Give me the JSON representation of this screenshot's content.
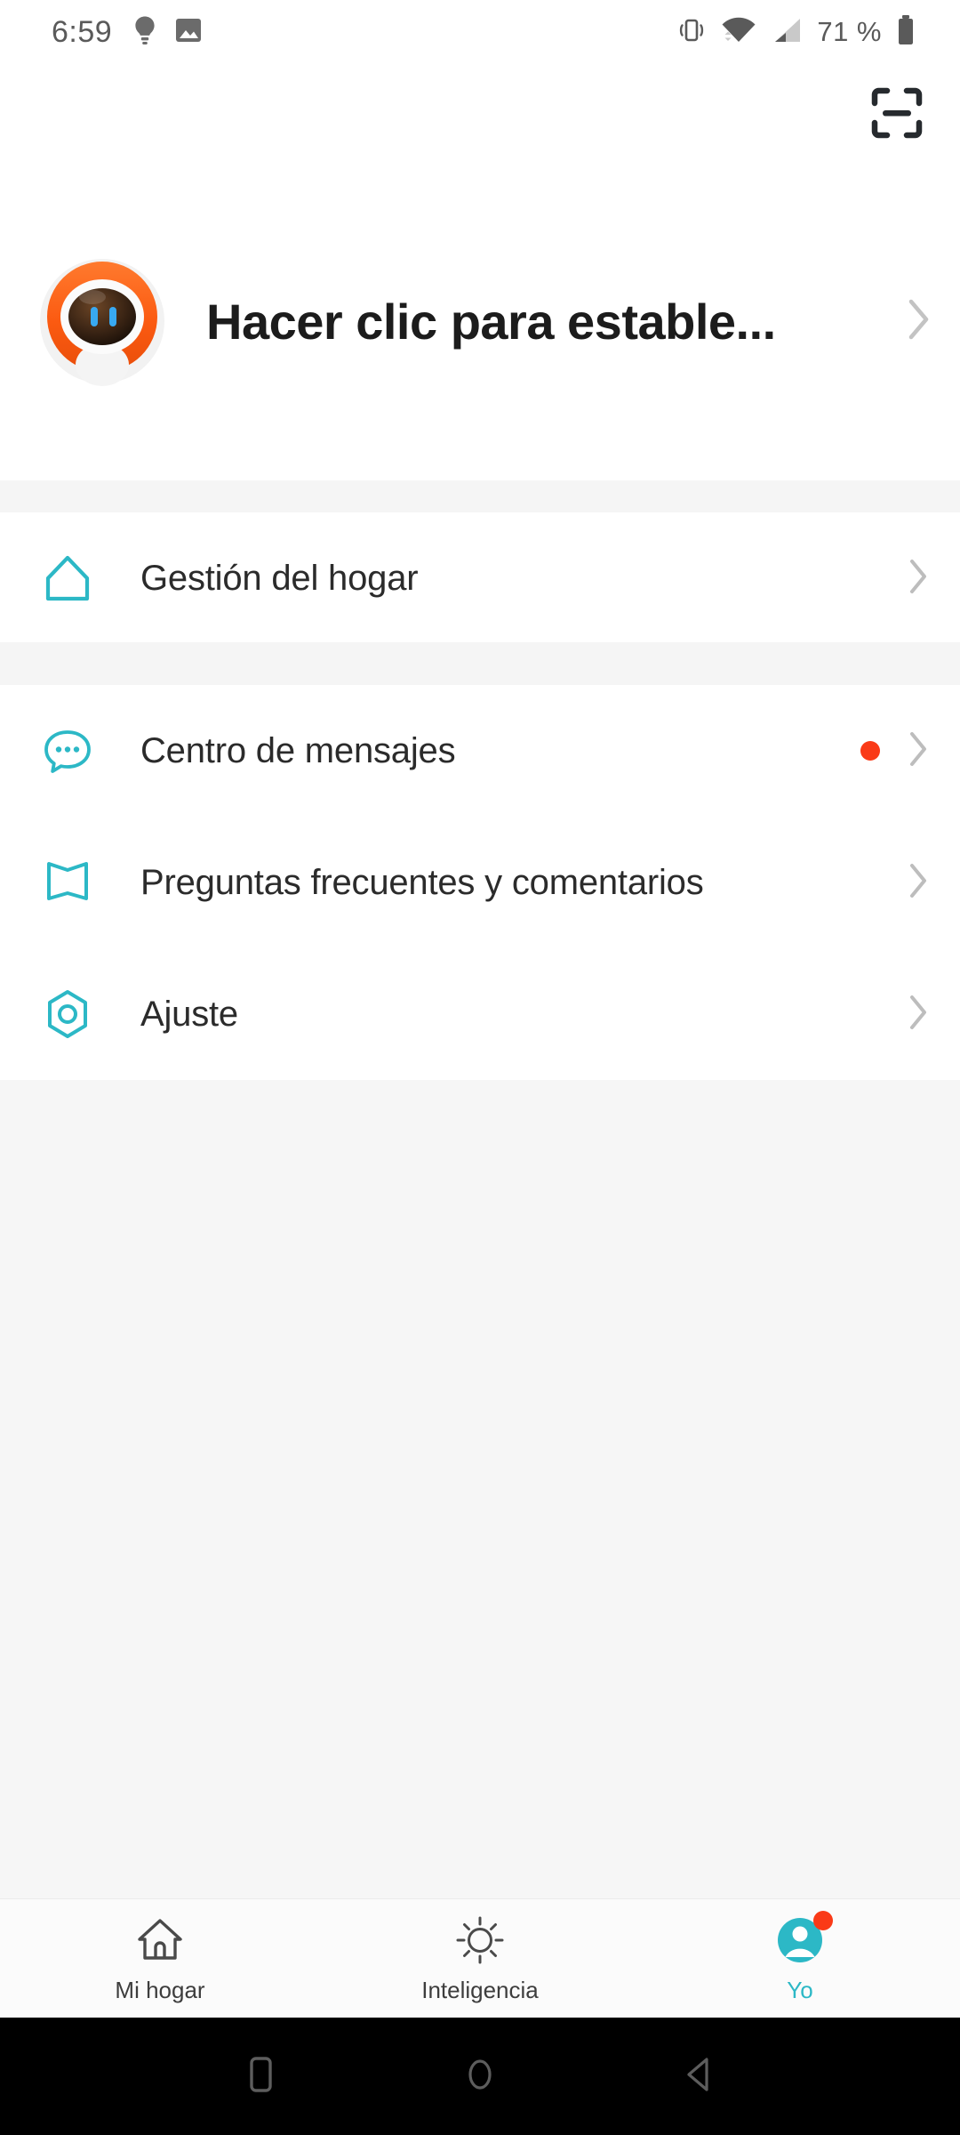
{
  "statusbar": {
    "time": "6:59",
    "battery_text": "71 %",
    "icons": [
      "lightbulb-icon",
      "image-icon",
      "vibrate-icon",
      "wifi-icon",
      "cellular-signal-icon",
      "battery-icon"
    ]
  },
  "topbar": {
    "scan_icon": "scan-icon"
  },
  "profile": {
    "title": "Hacer clic para estable...",
    "avatar_icon": "robot-avatar",
    "chevron": "chevron-right-icon",
    "colors": {
      "ring": "#fc5b14",
      "visor": "#2e1a0e",
      "eye": "#3aa8f0"
    }
  },
  "menu": {
    "section_one": [
      {
        "label": "Gestión del hogar",
        "icon": "home-outline-icon",
        "badge": false
      }
    ],
    "section_two": [
      {
        "label": "Centro de mensajes",
        "icon": "message-bubble-icon",
        "badge": true
      },
      {
        "label": "Preguntas frecuentes y comentarios",
        "icon": "book-icon",
        "badge": false
      },
      {
        "label": "Ajuste",
        "icon": "hexagon-settings-icon",
        "badge": false
      }
    ]
  },
  "tabbar": {
    "tabs": [
      {
        "label": "Mi hogar",
        "icon": "home-icon",
        "active": false,
        "badge": false
      },
      {
        "label": "Inteligencia",
        "icon": "sun-icon",
        "active": false,
        "badge": false
      },
      {
        "label": "Yo",
        "icon": "person-icon",
        "active": true,
        "badge": true
      }
    ]
  },
  "navbar": {
    "buttons": [
      {
        "icon": "recents-square-icon"
      },
      {
        "icon": "home-circle-icon"
      },
      {
        "icon": "back-triangle-icon"
      }
    ]
  },
  "colors": {
    "accent_teal": "#2cb8c6",
    "badge_red": "#fa3a17",
    "background_gray": "#f6f6f6",
    "card_white": "#ffffff",
    "text_primary": "#2b2b2b"
  }
}
